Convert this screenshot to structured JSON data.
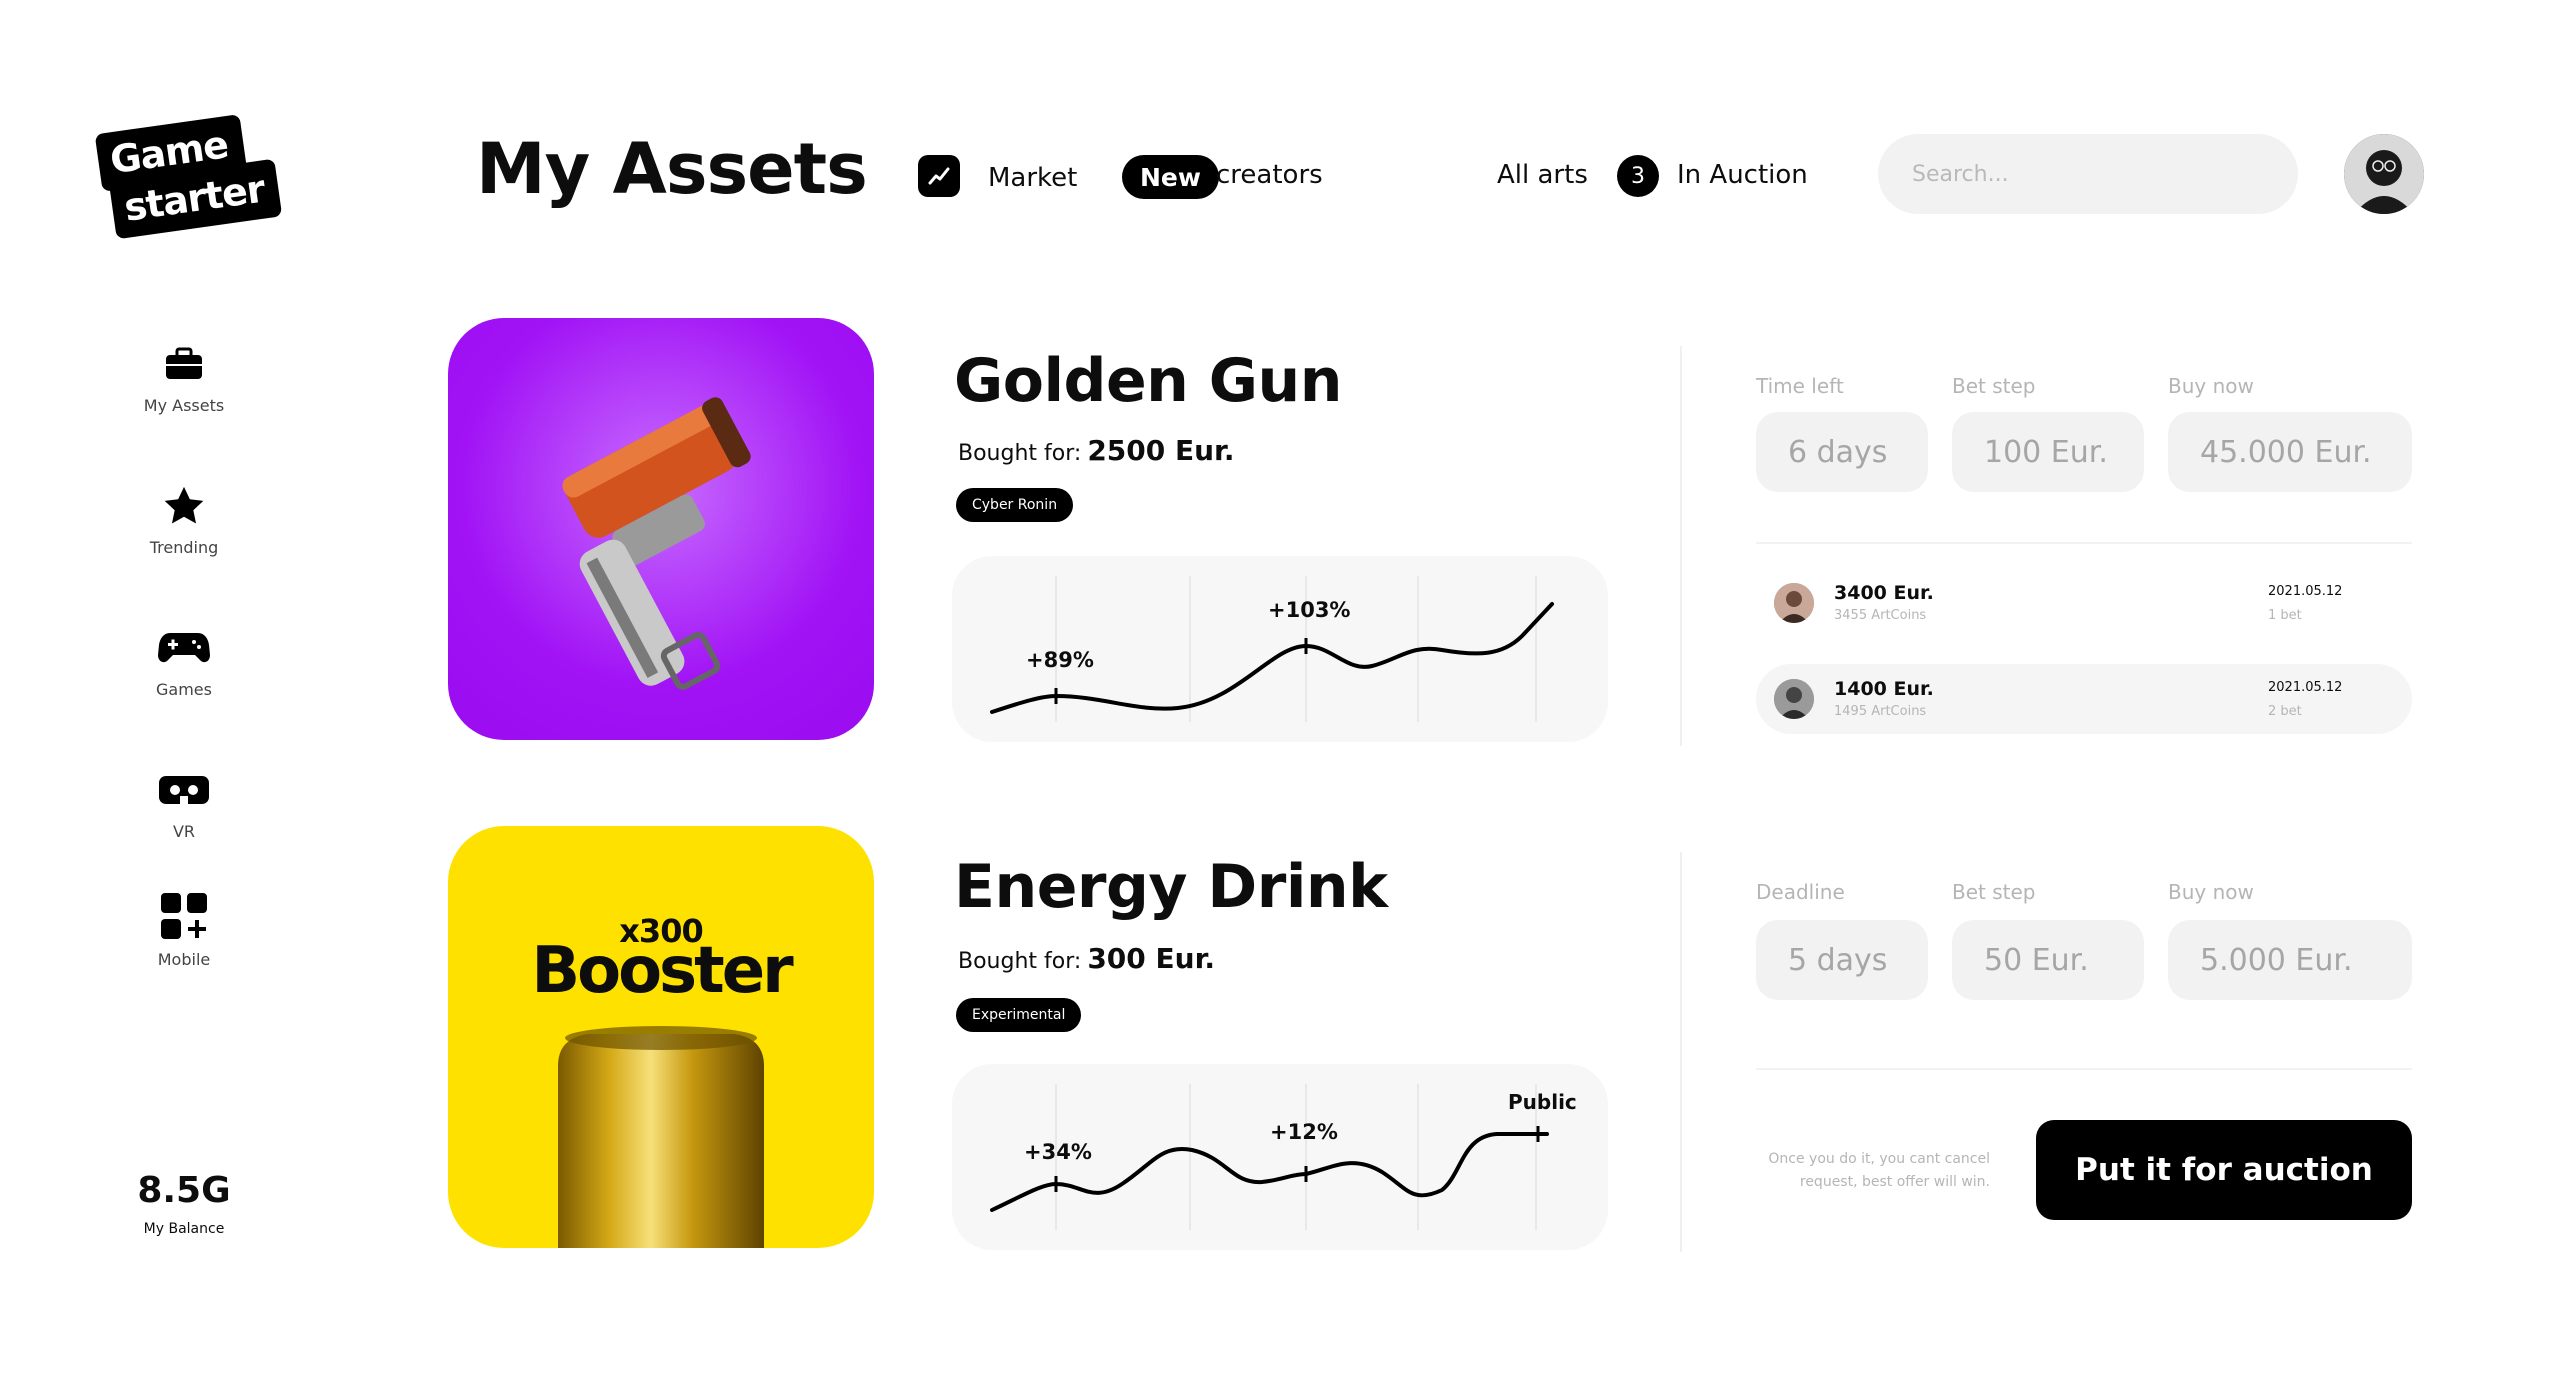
{
  "logo": {
    "line1": "Game",
    "line2": "starter"
  },
  "header": {
    "title": "My Assets",
    "market_label": "Market",
    "new_badge": "New",
    "creators_label": "creators",
    "all_arts_label": "All arts",
    "auction_count": "3",
    "auction_label": "In Auction",
    "search_placeholder": "Search..."
  },
  "sidebar": {
    "items": [
      {
        "label": "My Assets",
        "icon": "briefcase-icon"
      },
      {
        "label": "Trending",
        "icon": "star-icon"
      },
      {
        "label": "Games",
        "icon": "gamepad-icon"
      },
      {
        "label": "VR",
        "icon": "vr-headset-icon"
      },
      {
        "label": "Mobile",
        "icon": "apps-grid-icon"
      }
    ],
    "balance_value": "8.5G",
    "balance_label": "My Balance"
  },
  "assets": [
    {
      "name": "Golden Gun",
      "bought_label": "Bought for:",
      "bought_value": "2500 Eur.",
      "tag": "Cyber Ronin",
      "image_bg": "#a113f5",
      "graph_points": [
        {
          "label": "+89%"
        },
        {
          "label": "+103%"
        }
      ],
      "fields": [
        {
          "label": "Time left",
          "value": "6 days"
        },
        {
          "label": "Bet step",
          "value": "100 Eur."
        },
        {
          "label": "Buy now",
          "value": "45.000 Eur."
        }
      ],
      "bids": [
        {
          "amount": "3400 Eur.",
          "coins": "3455 ArtCoins",
          "date": "2021.05.12",
          "count": "1 bet"
        },
        {
          "amount": "1400 Eur.",
          "coins": "1495 ArtCoins",
          "date": "2021.05.12",
          "count": "2 bet"
        }
      ]
    },
    {
      "name": "Energy Drink",
      "bought_label": "Bought for:",
      "bought_value": "300 Eur.",
      "tag": "Experimental",
      "image_bg": "#ffe100",
      "image_text_top": "x300",
      "image_text_main": "Booster",
      "graph_points": [
        {
          "label": "+34%"
        },
        {
          "label": "+12%"
        },
        {
          "label": "Public"
        }
      ],
      "fields": [
        {
          "label": "Deadline",
          "value": "5 days"
        },
        {
          "label": "Bet step",
          "value": "50 Eur."
        },
        {
          "label": "Buy now",
          "value": "5.000 Eur."
        }
      ],
      "note": "Once you do it, you cant cancel request, best offer will win.",
      "cta": "Put it for auction"
    }
  ]
}
